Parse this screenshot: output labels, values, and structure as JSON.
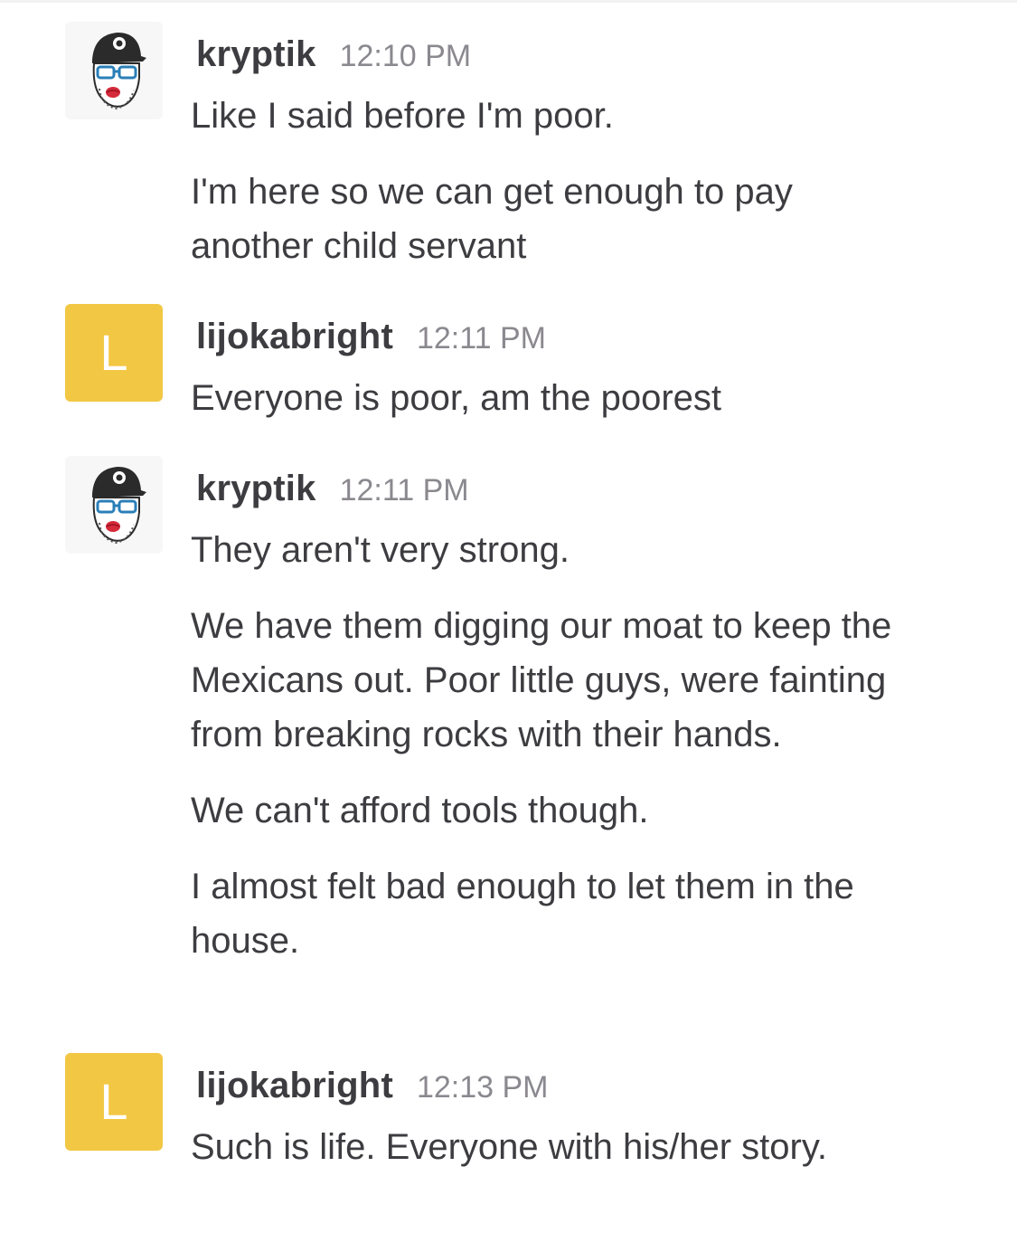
{
  "messages": [
    {
      "user": "kryptik",
      "time": "12:10 PM",
      "avatar": {
        "kind": "photo",
        "icon": "bearded-man-cap-avatar-icon"
      },
      "paragraphs": [
        "Like I said before I'm poor.",
        "I'm here so we can get enough to pay another child servant"
      ]
    },
    {
      "user": "lijokabright",
      "time": "12:11 PM",
      "avatar": {
        "kind": "letter",
        "letter": "L",
        "color": "#f2c744"
      },
      "paragraphs": [
        "Everyone is poor, am the poorest"
      ]
    },
    {
      "user": "kryptik",
      "time": "12:11 PM",
      "avatar": {
        "kind": "photo",
        "icon": "bearded-man-cap-avatar-icon"
      },
      "paragraphs": [
        "They aren't very strong.",
        "We have them digging our moat to keep the Mexicans out. Poor little guys, were fainting from breaking rocks with their hands.",
        "We can't afford tools though.",
        "I almost felt bad enough to let them in the house."
      ]
    },
    {
      "user": "lijokabright",
      "time": "12:13 PM",
      "avatar": {
        "kind": "letter",
        "letter": "L",
        "color": "#f2c744"
      },
      "paragraphs": [
        "Such is life. Everyone with his/her story."
      ]
    }
  ],
  "colors": {
    "username": "#3d3c40",
    "timestamp": "#8b898f",
    "text": "#3d3c40",
    "letter_avatar_bg": "#f2c744"
  }
}
